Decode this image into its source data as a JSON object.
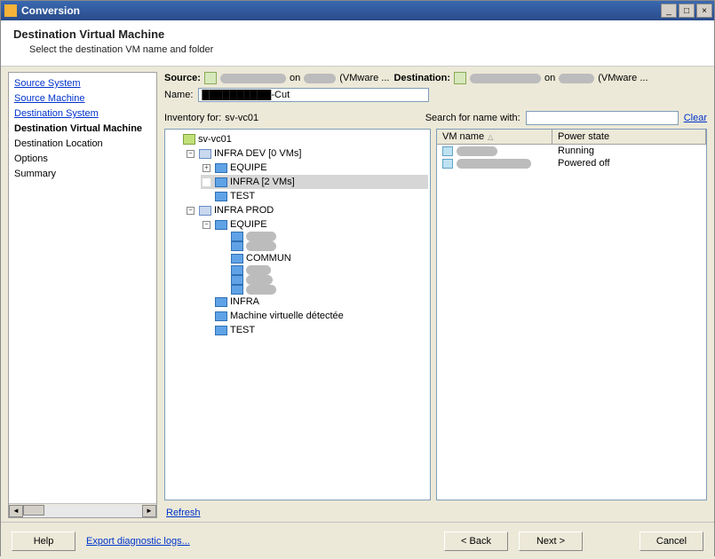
{
  "window": {
    "title": "Conversion"
  },
  "header": {
    "title": "Destination Virtual Machine",
    "subtitle": "Select the destination VM name and folder"
  },
  "nav": {
    "items": [
      {
        "label": "Source System",
        "type": "link"
      },
      {
        "label": "Source Machine",
        "type": "link"
      },
      {
        "label": "Destination System",
        "type": "link"
      },
      {
        "label": "Destination Virtual Machine",
        "type": "current"
      },
      {
        "label": "Destination Location",
        "type": "plain"
      },
      {
        "label": "Options",
        "type": "plain"
      },
      {
        "label": "Summary",
        "type": "plain"
      }
    ]
  },
  "srcdest": {
    "source_label": "Source:",
    "source_on": " on ",
    "source_tail": " (VMware ...",
    "dest_label": "Destination:",
    "dest_on": " on ",
    "dest_tail": " (VMware ..."
  },
  "namefield": {
    "label": "Name:",
    "value": "██████████-Cut"
  },
  "inventory": {
    "label": "Inventory for:",
    "host": "sv-vc01",
    "search_label": "Search for name with:",
    "search_value": "",
    "clear": "Clear"
  },
  "tree": {
    "root": "sv-vc01",
    "dc1": "INFRA DEV [0 VMs]",
    "dc1_children": {
      "equipe": "EQUIPE",
      "infra": "INFRA [2 VMs]",
      "test": "TEST"
    },
    "dc2": "INFRA PROD",
    "dc2_equipe": "EQUIPE",
    "equipe_children": {
      "c1": "████",
      "c2": "████",
      "c3": "COMMUN",
      "c4": "████",
      "c5": "████",
      "c6": "████"
    },
    "dc2_rest": {
      "infra": "INFRA",
      "mvd": "Machine virtuelle détectée",
      "test": "TEST"
    }
  },
  "list": {
    "col_name": "VM name",
    "col_state": "Power state",
    "rows": [
      {
        "name": "██████",
        "state": "Running"
      },
      {
        "name": "███████████",
        "state": "Powered off"
      }
    ]
  },
  "refresh": "Refresh",
  "footer": {
    "help": "Help",
    "diag": "Export diagnostic logs...",
    "back": "< Back",
    "next": "Next >",
    "cancel": "Cancel"
  }
}
